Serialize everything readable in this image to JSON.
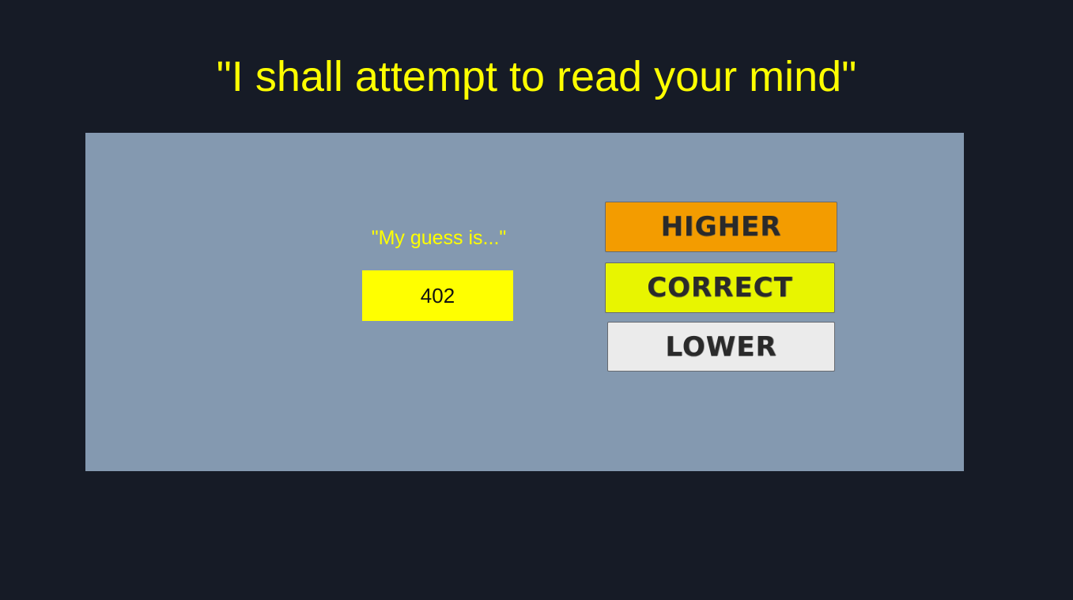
{
  "title": "\"I shall attempt to read your mind\"",
  "guess": {
    "label": "\"My guess is...\"",
    "value": "402"
  },
  "buttons": {
    "higher": "HIGHER",
    "correct": "CORRECT",
    "lower": "LOWER"
  },
  "colors": {
    "background": "#161b26",
    "panel": "#8499b0",
    "accent_text": "#ffff00",
    "higher_button": "#f39c00",
    "correct_button": "#e8f500",
    "lower_button": "#ebebeb"
  }
}
